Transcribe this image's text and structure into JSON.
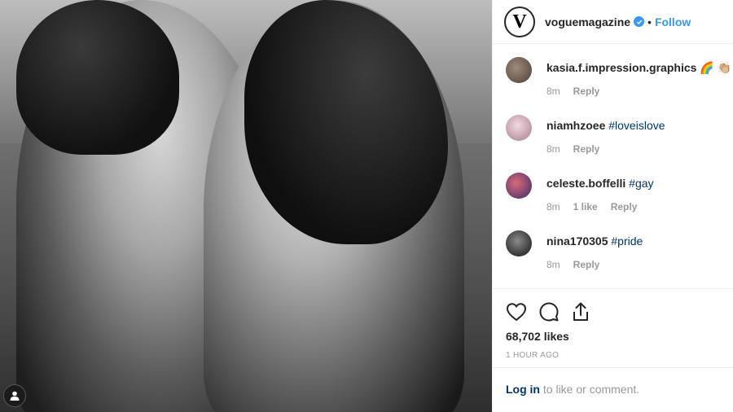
{
  "post": {
    "username": "voguemagazine",
    "avatar_letter": "V",
    "separator": "•",
    "follow_label": "Follow",
    "likes": "68,702 likes",
    "timestamp": "1 HOUR AGO",
    "login_link": "Log in",
    "login_suffix": " to like or comment."
  },
  "comments": [
    {
      "user": "kasia.f.impression.graphics",
      "text": " 🌈 👏🏼",
      "time": "8m",
      "likes": "",
      "reply": "Reply",
      "avatar_color": "#6b5a4e"
    },
    {
      "user": "niamhzoee",
      "text": " #loveislove",
      "time": "8m",
      "likes": "",
      "reply": "Reply",
      "avatar_color": "#c9a7b7"
    },
    {
      "user": "celeste.boffelli",
      "text": " #gay",
      "time": "8m",
      "likes": "1 like",
      "reply": "Reply",
      "avatar_color": "#9a4a5a"
    },
    {
      "user": "nina170305",
      "text": " #pride",
      "time": "8m",
      "likes": "",
      "reply": "Reply",
      "avatar_color": "#3b3b3b"
    }
  ],
  "colors": {
    "accent": "#3897f0",
    "hashtag": "#003569",
    "muted": "#999999",
    "text": "#262626"
  },
  "icons": [
    "heart-icon",
    "comment-icon",
    "share-icon",
    "verified-badge-icon",
    "user-tag-icon"
  ]
}
